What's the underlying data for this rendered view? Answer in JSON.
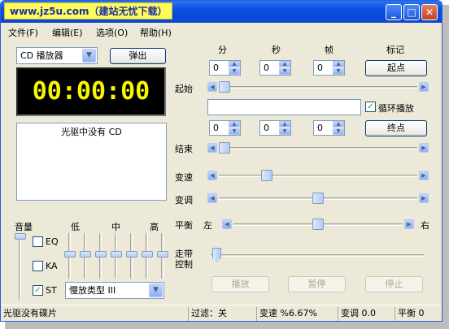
{
  "window": {
    "title": "www.jz5u.com（建站无忧下载）",
    "buttons": {
      "minimize": "_",
      "maximize": "□",
      "close": "✕"
    }
  },
  "menu": [
    "文件(F)",
    "编辑(E)",
    "选项(O)",
    "帮助(H)"
  ],
  "player": {
    "mode_select": "CD 播放器",
    "eject_label": "弹出",
    "time_display": "00:00:00",
    "info_text": "光驱中没有 CD"
  },
  "position": {
    "col_minutes": "分",
    "col_seconds": "秒",
    "col_frames": "帧",
    "col_mark": "标记",
    "start_label": "起始",
    "end_label": "结束",
    "start_min": "0",
    "start_sec": "0",
    "start_frame": "0",
    "end_min": "0",
    "end_sec": "0",
    "end_frame": "0",
    "start_point_button": "起点",
    "end_point_button": "终点",
    "loop_label": "循环播放",
    "loop_checked": true
  },
  "sliders": {
    "speed_label": "变速",
    "pitch_label": "变调",
    "balance_label": "平衡",
    "balance_left": "左",
    "balance_right": "右",
    "tape_label_1": "走带",
    "tape_label_2": "控制"
  },
  "eq": {
    "volume_label": "音量",
    "low_label": "低",
    "mid_label": "中",
    "high_label": "高",
    "eq_label": "EQ",
    "ka_label": "KA",
    "st_label": "ST",
    "st_checked": true,
    "slowdown_select": "慢放类型 III"
  },
  "transport": {
    "play": "播放",
    "pause": "暂停",
    "stop": "停止"
  },
  "status": {
    "cell1": "光驱没有碟片",
    "cell2": "过滤：关",
    "cell3": "变速 %6.67%",
    "cell4": "变调 0.0",
    "cell5": "平衡 0"
  },
  "colors": {
    "title_bg": "#fffc5a",
    "title_text": "#1b2fa6",
    "lcd_bg": "#000000",
    "lcd_text": "#f7f700"
  }
}
